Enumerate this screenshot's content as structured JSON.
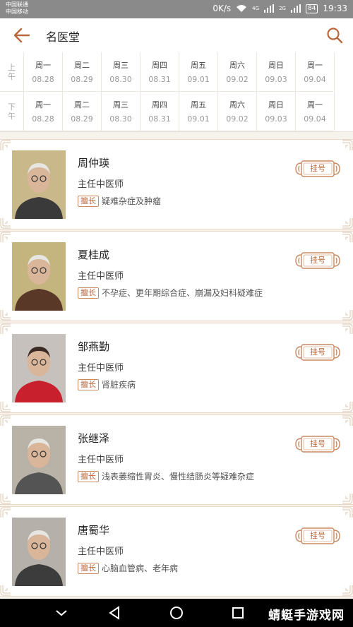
{
  "status_bar": {
    "carrier_1": "中国联通",
    "carrier_2": "中国移动",
    "speed": "0K/s",
    "signal_tag_1": "4G",
    "signal_tag_2": "2G",
    "battery": "84",
    "time": "19:33"
  },
  "header": {
    "title": "名医堂",
    "back_icon": "arrow-left-icon",
    "search_icon": "search-icon"
  },
  "schedule": {
    "rows": [
      {
        "period": [
          "上",
          "午"
        ]
      },
      {
        "period": [
          "下",
          "午"
        ]
      }
    ],
    "days": [
      {
        "weekday": "周一",
        "date": "08.28"
      },
      {
        "weekday": "周二",
        "date": "08.29"
      },
      {
        "weekday": "周三",
        "date": "08.30"
      },
      {
        "weekday": "周四",
        "date": "08.31"
      },
      {
        "weekday": "周五",
        "date": "09.01"
      },
      {
        "weekday": "周六",
        "date": "09.02"
      },
      {
        "weekday": "周日",
        "date": "09.03"
      },
      {
        "weekday": "周一",
        "date": "09.04"
      }
    ]
  },
  "doctors": [
    {
      "name": "周仲瑛",
      "title": "主任中医师",
      "specialty_tag": "擅长",
      "specialty": "疑难杂症及肿瘤",
      "book_label": "挂号"
    },
    {
      "name": "夏桂成",
      "title": "主任中医师",
      "specialty_tag": "擅长",
      "specialty": "不孕症、更年期综合症、崩漏及妇科疑难症",
      "book_label": "挂号"
    },
    {
      "name": "邹燕勤",
      "title": "主任中医师",
      "specialty_tag": "擅长",
      "specialty": "肾脏疾病",
      "book_label": "挂号"
    },
    {
      "name": "张继泽",
      "title": "主任中医师",
      "specialty_tag": "擅长",
      "specialty": "浅表萎缩性胃炎、慢性结肠炎等疑难杂症",
      "book_label": "挂号"
    },
    {
      "name": "唐蜀华",
      "title": "主任中医师",
      "specialty_tag": "擅长",
      "specialty": "心脑血管病、老年病",
      "book_label": "挂号"
    }
  ],
  "nav_bar": {
    "watermark": "蜻蜓手游戏网"
  },
  "colors": {
    "accent": "#b8683d",
    "tag_border": "#c98a63",
    "background": "#f6f2ec",
    "status_bar": "#8a8a8a"
  }
}
